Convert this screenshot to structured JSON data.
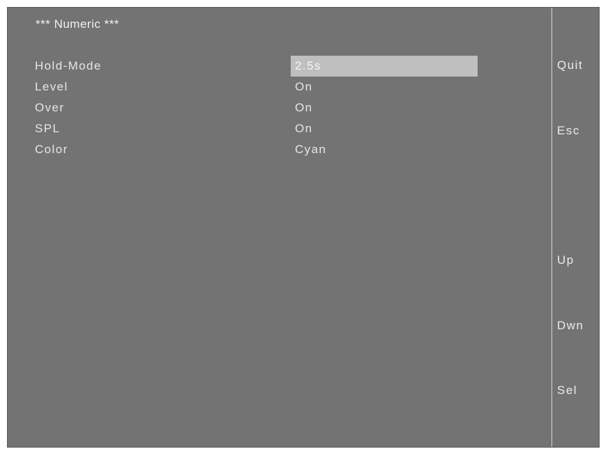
{
  "screen": {
    "title": "*** Numeric ***"
  },
  "menu": {
    "items": [
      {
        "label": "Hold-Mode",
        "value": "2.5s",
        "selected": true
      },
      {
        "label": "Level",
        "value": "On",
        "selected": false
      },
      {
        "label": "Over",
        "value": "On",
        "selected": false
      },
      {
        "label": "SPL",
        "value": "On",
        "selected": false
      },
      {
        "label": "Color",
        "value": "Cyan",
        "selected": false
      }
    ]
  },
  "softkeys": {
    "quit": "Quit",
    "esc": "Esc",
    "up": "Up",
    "dwn": "Dwn",
    "sel": "Sel"
  },
  "colors": {
    "background": "#737373",
    "highlight": "#bfbfbf",
    "text": "#e6e6e6"
  }
}
